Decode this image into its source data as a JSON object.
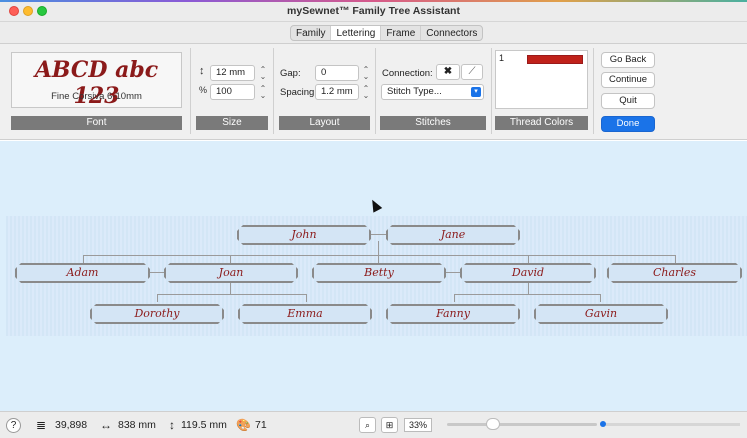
{
  "window": {
    "title": "mySewnet™ Family Tree Assistant"
  },
  "tabs": [
    {
      "label": "Family",
      "active": false
    },
    {
      "label": "Lettering",
      "active": true
    },
    {
      "label": "Frame",
      "active": false
    },
    {
      "label": "Connectors",
      "active": false
    }
  ],
  "ribbon": {
    "font": {
      "sample": "ABCD abc 123",
      "name": "Fine Corsiva 6-10mm",
      "group_label": "Font"
    },
    "size": {
      "height_value": "12 mm",
      "width_value": "100",
      "group_label": "Size"
    },
    "layout": {
      "gap_label": "Gap:",
      "gap_value": "0",
      "spacing_label": "Spacing:",
      "spacing_value": "1.2 mm",
      "group_label": "Layout"
    },
    "stitches": {
      "connection_label": "Connection:",
      "stitch_type": "Stitch Type...",
      "group_label": "Stitches"
    },
    "thread_colors": {
      "number": "1",
      "swatch_color": "#c0221a",
      "group_label": "Thread Colors"
    },
    "buttons": {
      "go_back": "Go Back",
      "continue": "Continue",
      "quit": "Quit",
      "done": "Done"
    }
  },
  "tree": {
    "row1": [
      "John",
      "Jane"
    ],
    "row2": [
      "Adam",
      "Joan",
      "Betty",
      "David",
      "Charles"
    ],
    "row3": [
      "Dorothy",
      "Emma",
      "Fanny",
      "Gavin"
    ]
  },
  "status": {
    "stitch_count": "39,898",
    "width": "838 mm",
    "height": "119.5 mm",
    "colors": "71",
    "zoom": "33%"
  },
  "colors": {
    "accent": "#1a73e8",
    "name_text": "#8b1a1a",
    "canvas_bg": "#dceefb"
  }
}
